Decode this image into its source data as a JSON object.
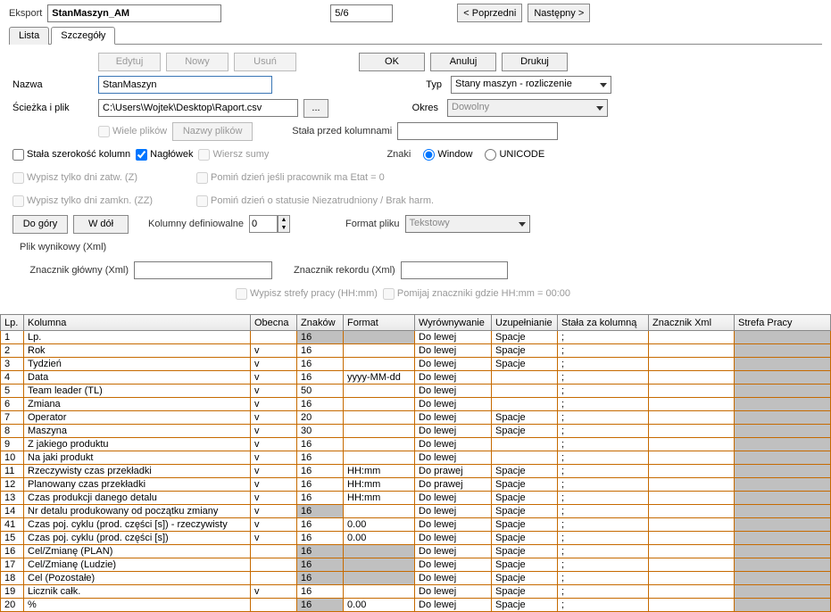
{
  "top": {
    "eksport": "Eksport",
    "name": "StanMaszyn_AM",
    "page": "5/6",
    "prev": "< Poprzedni",
    "next": "Następny >"
  },
  "tabs": {
    "lista": "Lista",
    "szczegoly": "Szczegóły"
  },
  "form": {
    "edytuj": "Edytuj",
    "nowy": "Nowy",
    "usun": "Usuń",
    "ok": "OK",
    "anuluj": "Anuluj",
    "drukuj": "Drukuj",
    "nazwa_lbl": "Nazwa",
    "nazwa_val": "StanMaszyn",
    "typ_lbl": "Typ",
    "typ_val": "Stany maszyn - rozliczenie",
    "sciezka_lbl": "Ścieżka i plik",
    "sciezka_val": "C:\\Users\\Wojtek\\Desktop\\Raport.csv",
    "browse": "...",
    "okres_lbl": "Okres",
    "okres_val": "Dowolny",
    "wiele_plikow": "Wiele plików",
    "nazwy_plikow": "Nazwy plików",
    "stala_przed_lbl": "Stała przed kolumnami",
    "stala_przed_val": "",
    "stala_szer": "Stała szerokość kolumn",
    "naglowek": "Nagłówek",
    "wiersz_sumy": "Wiersz sumy",
    "znaki_lbl": "Znaki",
    "znaki_window": "Window",
    "znaki_unicode": "UNICODE",
    "wypis_zatw": "Wypisz tylko dni zatw. (Z)",
    "pomin_etat": "Pomiń dzień jeśli pracownik ma Etat = 0",
    "wypis_zamkn": "Wypisz tylko dni zamkn. (ZZ)",
    "pomin_niez": "Pomiń dzień o statusie Niezatrudniony / Brak harm.",
    "do_gory": "Do góry",
    "w_dol": "W dół",
    "kol_def_lbl": "Kolumny definiowalne",
    "kol_def_val": "0",
    "format_pliku_lbl": "Format pliku",
    "format_pliku_val": "Tekstowy",
    "plik_xml_lbl": "Plik wynikowy (Xml)",
    "znacznik_gl_lbl": "Znacznik główny (Xml)",
    "znacznik_gl_val": "",
    "znacznik_rek_lbl": "Znacznik rekordu (Xml)",
    "znacznik_rek_val": "",
    "wypis_strefy": "Wypisz strefy pracy (HH:mm)",
    "pomijaj_znacz": "Pomijaj znaczniki gdzie HH:mm = 00:00"
  },
  "headers": [
    "Lp.",
    "Kolumna",
    "Obecna",
    "Znaków",
    "Format",
    "Wyrównywanie",
    "Uzupełnianie",
    "Stała za kolumną",
    "Znacznik Xml",
    "Strefa Pracy"
  ],
  "rows": [
    {
      "lp": "1",
      "k": "Lp.",
      "o": "",
      "z": "16",
      "f": "",
      "w": "Do lewej",
      "u": "Spacje",
      "s": ";",
      "x": "",
      "sp": "",
      "zg": true,
      "xg": false
    },
    {
      "lp": "2",
      "k": "Rok",
      "o": "v",
      "z": "16",
      "f": "",
      "w": "Do lewej",
      "u": "Spacje",
      "s": ";",
      "x": "",
      "sp": "",
      "zg": false,
      "xg": false
    },
    {
      "lp": "3",
      "k": "Tydzień",
      "o": "v",
      "z": "16",
      "f": "",
      "w": "Do lewej",
      "u": "Spacje",
      "s": ";",
      "x": "",
      "sp": "",
      "zg": false,
      "xg": false
    },
    {
      "lp": "4",
      "k": "Data",
      "o": "v",
      "z": "16",
      "f": "yyyy-MM-dd",
      "w": "Do lewej",
      "u": "",
      "s": ";",
      "x": "",
      "sp": "",
      "zg": false,
      "xg": false
    },
    {
      "lp": "5",
      "k": "Team leader (TL)",
      "o": "v",
      "z": "50",
      "f": "",
      "w": "Do lewej",
      "u": "",
      "s": ";",
      "x": "",
      "sp": "",
      "zg": false,
      "xg": false
    },
    {
      "lp": "6",
      "k": "Zmiana",
      "o": "v",
      "z": "16",
      "f": "",
      "w": "Do lewej",
      "u": "",
      "s": ";",
      "x": "",
      "sp": "",
      "zg": false,
      "xg": false
    },
    {
      "lp": "7",
      "k": "Operator",
      "o": "v",
      "z": "20",
      "f": "",
      "w": "Do lewej",
      "u": "Spacje",
      "s": ";",
      "x": "",
      "sp": "",
      "zg": false,
      "xg": false
    },
    {
      "lp": "8",
      "k": "Maszyna",
      "o": "v",
      "z": "30",
      "f": "",
      "w": "Do lewej",
      "u": "Spacje",
      "s": ";",
      "x": "",
      "sp": "",
      "zg": false,
      "xg": false
    },
    {
      "lp": "9",
      "k": "Z jakiego produktu",
      "o": "v",
      "z": "16",
      "f": "",
      "w": "Do lewej",
      "u": "",
      "s": ";",
      "x": "",
      "sp": "",
      "zg": false,
      "xg": false
    },
    {
      "lp": "10",
      "k": "Na jaki produkt",
      "o": "v",
      "z": "16",
      "f": "",
      "w": "Do lewej",
      "u": "",
      "s": ";",
      "x": "",
      "sp": "",
      "zg": false,
      "xg": false
    },
    {
      "lp": "11",
      "k": "Rzeczywisty czas przekładki",
      "o": "v",
      "z": "16",
      "f": "HH:mm",
      "w": "Do prawej",
      "u": "Spacje",
      "s": ";",
      "x": "",
      "sp": "",
      "zg": false,
      "xg": false
    },
    {
      "lp": "12",
      "k": "Planowany czas przekładki",
      "o": "v",
      "z": "16",
      "f": "HH:mm",
      "w": "Do prawej",
      "u": "Spacje",
      "s": ";",
      "x": "",
      "sp": "",
      "zg": false,
      "xg": false
    },
    {
      "lp": "13",
      "k": "Czas produkcji danego detalu",
      "o": "v",
      "z": "16",
      "f": "HH:mm",
      "w": "Do lewej",
      "u": "Spacje",
      "s": ";",
      "x": "",
      "sp": "",
      "zg": false,
      "xg": false
    },
    {
      "lp": "14",
      "k": "Nr detalu produkowany od początku zmiany",
      "o": "v",
      "z": "16",
      "f": "",
      "w": "Do lewej",
      "u": "Spacje",
      "s": ";",
      "x": "",
      "sp": "",
      "zg": true,
      "xg": false
    },
    {
      "lp": "41",
      "k": "Czas poj. cyklu (prod. części [s]) - rzeczywisty",
      "o": "v",
      "z": "16",
      "f": "0.00",
      "w": "Do lewej",
      "u": "Spacje",
      "s": ";",
      "x": "",
      "sp": "",
      "zg": false,
      "xg": false
    },
    {
      "lp": "15",
      "k": "Czas poj. cyklu (prod. części [s])",
      "o": "v",
      "z": "16",
      "f": "0.00",
      "w": "Do lewej",
      "u": "Spacje",
      "s": ";",
      "x": "",
      "sp": "",
      "zg": false,
      "xg": false
    },
    {
      "lp": "16",
      "k": "Cel/Zmianę (PLAN)",
      "o": "",
      "z": "16",
      "f": "",
      "w": "Do lewej",
      "u": "Spacje",
      "s": ";",
      "x": "",
      "sp": "",
      "zg": true,
      "xg": false
    },
    {
      "lp": "17",
      "k": "Cel/Zmianę (Ludzie)",
      "o": "",
      "z": "16",
      "f": "",
      "w": "Do lewej",
      "u": "Spacje",
      "s": ";",
      "x": "",
      "sp": "",
      "zg": true,
      "xg": false
    },
    {
      "lp": "18",
      "k": "Cel (Pozostałe)",
      "o": "",
      "z": "16",
      "f": "",
      "w": "Do lewej",
      "u": "Spacje",
      "s": ";",
      "x": "",
      "sp": "",
      "zg": true,
      "xg": false
    },
    {
      "lp": "19",
      "k": "Licznik całk.",
      "o": "v",
      "z": "16",
      "f": "",
      "w": "Do lewej",
      "u": "Spacje",
      "s": ";",
      "x": "",
      "sp": "",
      "zg": false,
      "xg": false
    },
    {
      "lp": "20",
      "k": "%",
      "o": "",
      "z": "16",
      "f": "0.00",
      "w": "Do lewej",
      "u": "Spacje",
      "s": ";",
      "x": "",
      "sp": "",
      "zg": true,
      "xg": false
    }
  ]
}
